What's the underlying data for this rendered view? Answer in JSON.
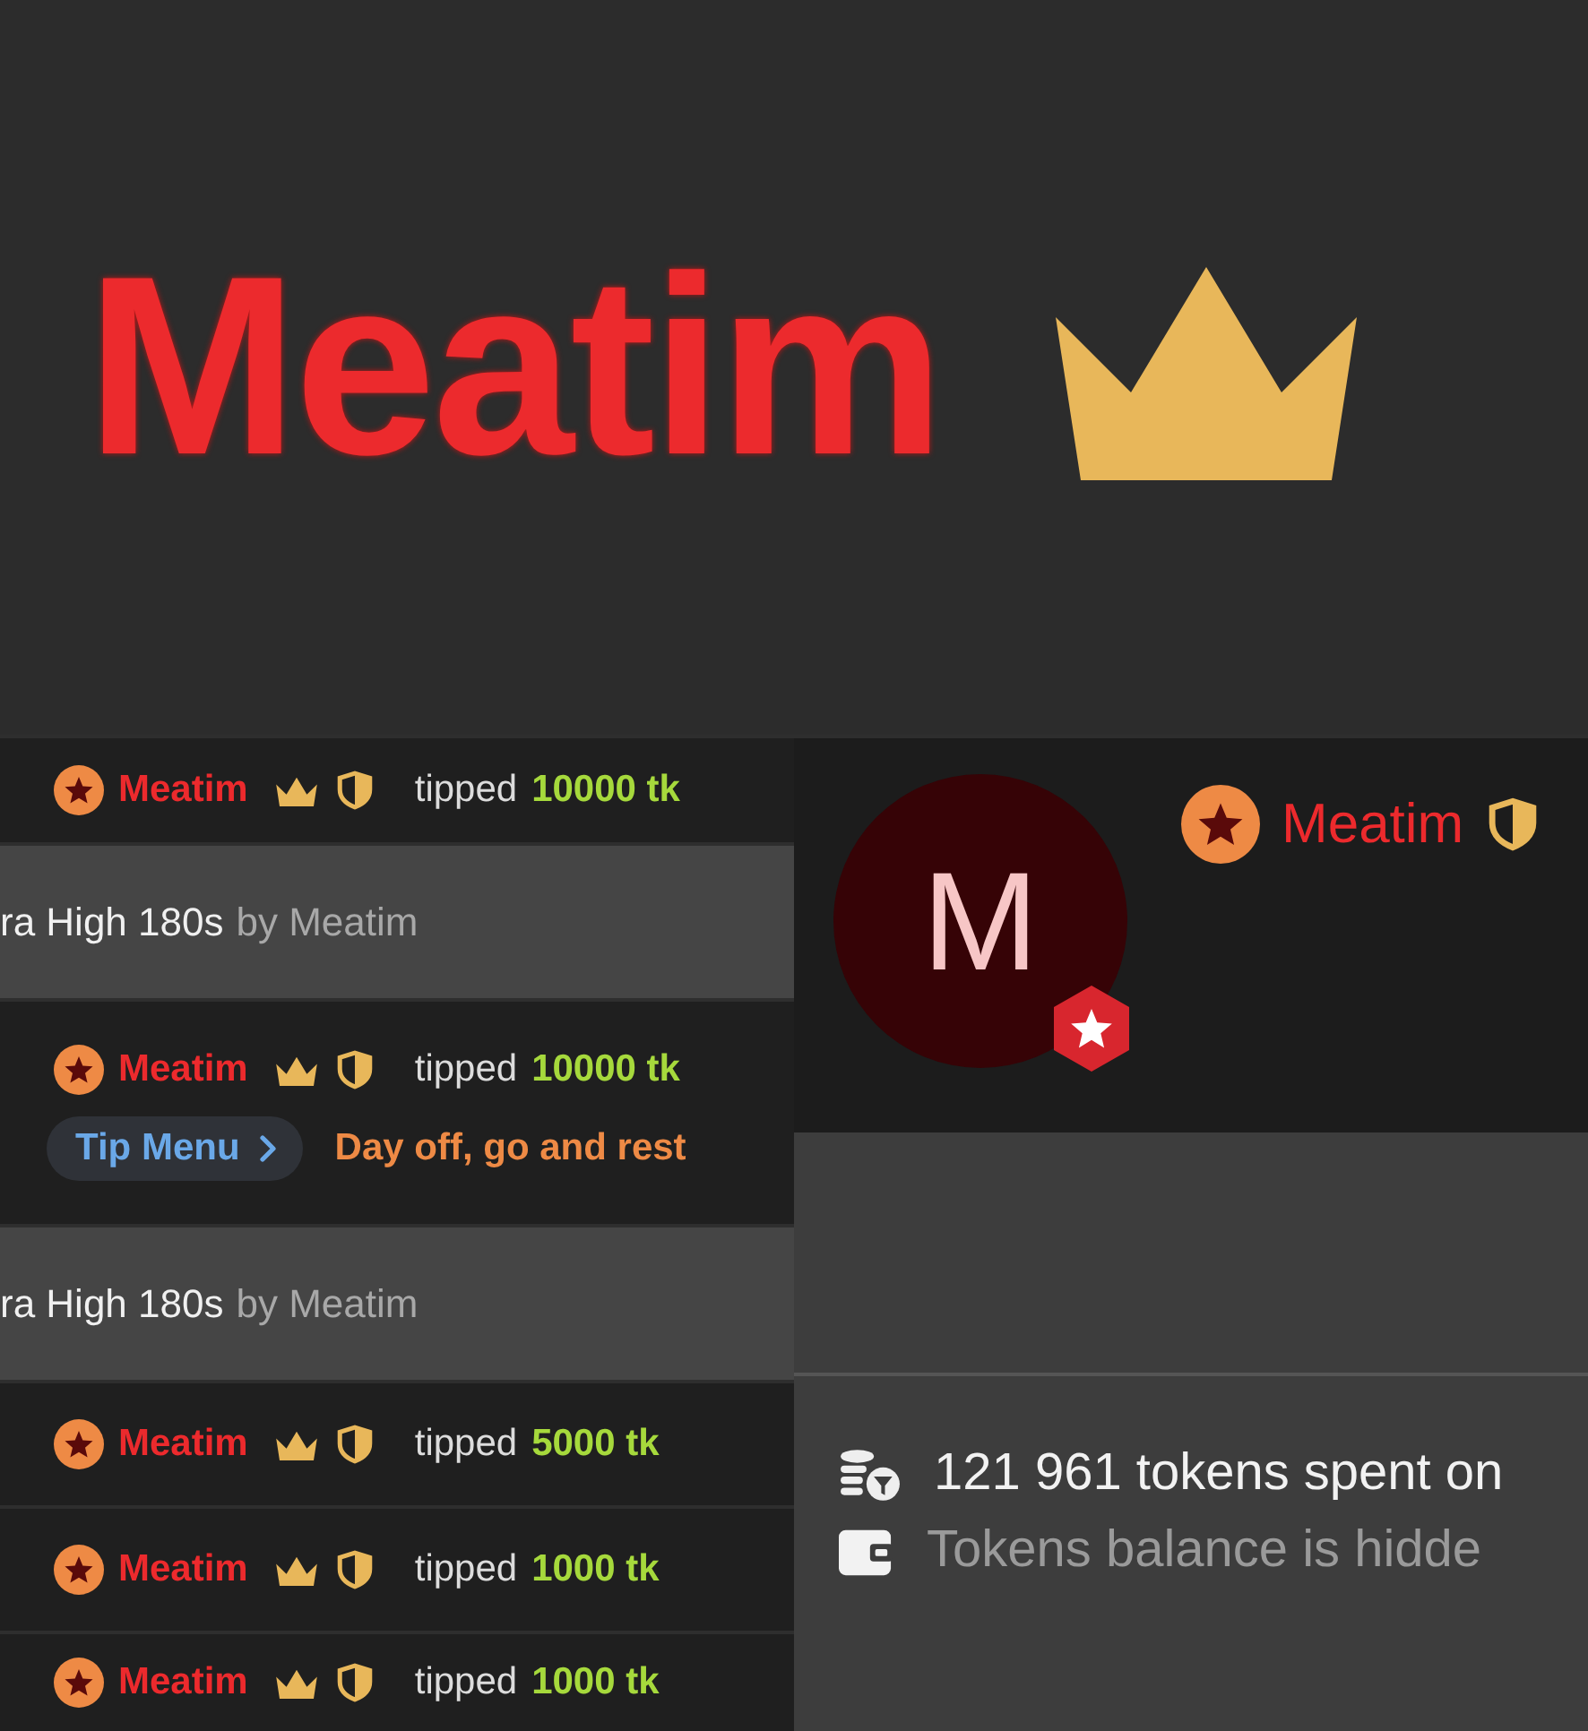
{
  "banner": {
    "name": "Meatim",
    "crown": true
  },
  "feed": [
    {
      "kind": "tip",
      "user": "Meatim",
      "crown": true,
      "shield": true,
      "verb": "tipped",
      "amount": "10000 tk"
    },
    {
      "kind": "song",
      "title": "ra High 180s",
      "by": "by Meatim"
    },
    {
      "kind": "tip",
      "user": "Meatim",
      "crown": true,
      "shield": true,
      "verb": "tipped",
      "amount": "10000 tk",
      "menu_label": "Tip Menu",
      "menu_item": "Day off, go and rest"
    },
    {
      "kind": "song",
      "title": "ra High 180s",
      "by": "by Meatim"
    },
    {
      "kind": "tip",
      "user": "Meatim",
      "crown": true,
      "shield": true,
      "verb": "tipped",
      "amount": "5000 tk"
    },
    {
      "kind": "tip",
      "user": "Meatim",
      "crown": true,
      "shield": true,
      "verb": "tipped",
      "amount": "1000 tk"
    },
    {
      "kind": "tip",
      "user": "Meatim",
      "crown": true,
      "shield": true,
      "verb": "tipped",
      "amount": "1000 tk"
    }
  ],
  "profile": {
    "initial": "M",
    "name": "Meatim",
    "crown": false,
    "shield": true
  },
  "stats": [
    {
      "kind": "spent",
      "text": "121 961 tokens spent on"
    },
    {
      "kind": "balance",
      "text": "Tokens balance is hidde"
    }
  ]
}
